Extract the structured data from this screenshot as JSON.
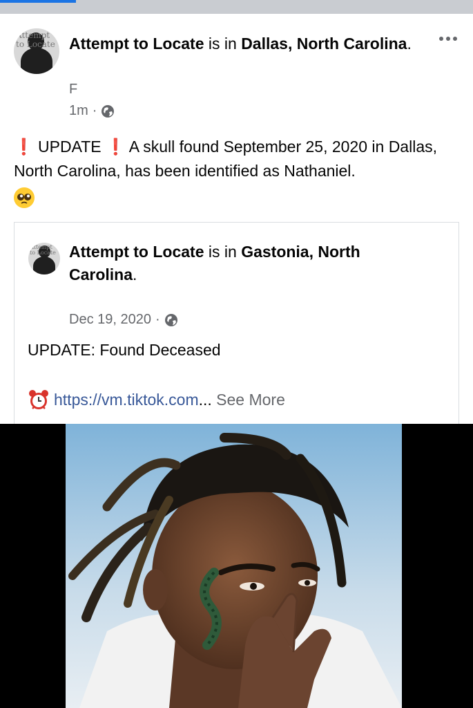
{
  "post": {
    "author": "Attempt to Locate",
    "connector": "is in",
    "location": "Dallas, North Carolina",
    "sub_line": "F",
    "time": "1m",
    "separator": "·",
    "update_word": "UPDATE",
    "message": "A skull found September 25, 2020 in Dallas, North Carolina, has been identified as Nathaniel.",
    "exclamation": "❗",
    "avatar_watermark": "Attempt to Locate"
  },
  "shared": {
    "author": "Attempt to Locate",
    "connector": "is in",
    "location": "Gastonia, North Carolina",
    "date": "Dec 19, 2020",
    "separator": "·",
    "status": "UPDATE: Found Deceased",
    "link_text": "https://vm.tiktok.com",
    "ellipsis": "...",
    "see_more": "See More",
    "avatar_watermark": "Attempt to Locate"
  },
  "icons": {
    "more": "more-options-icon",
    "globe": "globe-icon",
    "alarm": "alarm-clock-icon",
    "pleading_face": "pleading-face-emoji"
  },
  "colors": {
    "link": "#385898",
    "meta": "#65676b",
    "accent": "#1b74e4",
    "exclamation": "#e0221b"
  }
}
